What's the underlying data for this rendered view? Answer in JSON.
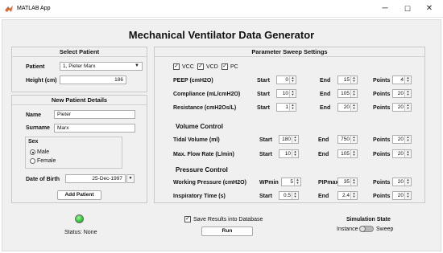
{
  "window": {
    "title": "MATLAB App",
    "minimize_glyph": "─",
    "maximize_glyph": "☐",
    "close_glyph": "✕"
  },
  "app_title": "Mechanical Ventilator Data Generator",
  "select_patient": {
    "title": "Select Patient",
    "patient_label": "Patient",
    "patient_value": "1, Pieter Marx",
    "height_label": "Height (cm)",
    "height_value": "186"
  },
  "new_patient": {
    "title": "New Patient Details",
    "name_label": "Name",
    "name_value": "Pieter",
    "surname_label": "Surname",
    "surname_value": "Marx",
    "sex_label": "Sex",
    "sex_options": [
      "Male",
      "Female"
    ],
    "sex_selected": "Male",
    "dob_label": "Date of Birth",
    "dob_value": "25-Dec-1997",
    "add_button": "Add Patient"
  },
  "param_sweep": {
    "title": "Parameter Sweep Settings",
    "modes": [
      {
        "label": "VCC",
        "checked": true
      },
      {
        "label": "VCD",
        "checked": true
      },
      {
        "label": "PC",
        "checked": true
      }
    ],
    "start_label": "Start",
    "end_label": "End",
    "points_label": "Points",
    "rows": [
      {
        "label": "PEEP (cmH2O)",
        "start": "0",
        "end": "15",
        "points": "4"
      },
      {
        "label": "Compliance (mL/cmH2O)",
        "start": "10",
        "end": "105",
        "points": "20"
      },
      {
        "label": "Resistance (cmH2Os/L)",
        "start": "1",
        "end": "20",
        "points": "20"
      }
    ],
    "volume_control": {
      "title": "Volume Control",
      "rows": [
        {
          "label": "Tidal Volume (ml)",
          "start": "180",
          "end": "750",
          "points": "20"
        },
        {
          "label": "Max. Flow Rate (L/min)",
          "start": "10",
          "end": "105",
          "points": "20"
        }
      ]
    },
    "pressure_control": {
      "title": "Pressure Control",
      "working_label": "Working Pressure (cmH2O)",
      "wpmin_label": "WPmin",
      "wpmin_value": "5",
      "pipmax_label": "PIPmax",
      "pipmax_value": "35",
      "working_points": "20",
      "insp_label": "Inspiratory Time (s)",
      "insp_start": "0.5",
      "insp_end": "2.4",
      "insp_points": "20"
    }
  },
  "status": {
    "lamp_color": "#2fc42f",
    "text": "Status: None"
  },
  "save_results": {
    "label": "Save Results into Database",
    "checked": true
  },
  "run_button": "Run",
  "simulation_state": {
    "title": "Simulation State",
    "left": "Instance",
    "right": "Sweep",
    "value": "Instance"
  }
}
